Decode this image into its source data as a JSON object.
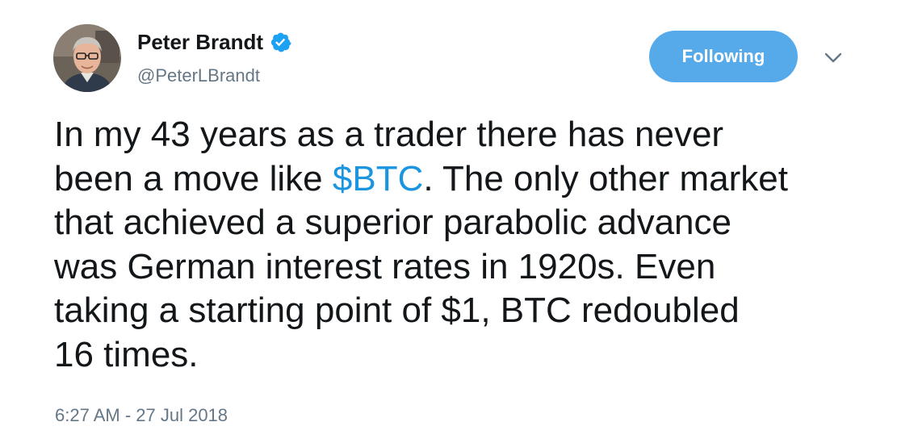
{
  "user": {
    "display_name": "Peter Brandt",
    "handle": "@PeterLBrandt",
    "verified": true
  },
  "header": {
    "follow_label": "Following"
  },
  "tweet": {
    "lines": [
      {
        "text": "In my 43 years as a trader there has never"
      },
      {
        "before": "been a move like ",
        "cashtag": "$BTC",
        "after": ". The only other market"
      },
      {
        "text": "that achieved a superior parabolic advance"
      },
      {
        "text": "was German interest rates in 1920s. Even"
      },
      {
        "text": "taking a starting point of $1, BTC redoubled"
      },
      {
        "text": "16 times."
      }
    ],
    "timestamp": "6:27 AM - 27 Jul 2018"
  },
  "colors": {
    "follow_button": "#57aaea",
    "link": "#1b95e0",
    "secondary_text": "#657786",
    "verified_badge": "#1da1f2"
  },
  "icons": {
    "verified": "verified-badge-icon",
    "menu": "chevron-down-icon"
  }
}
